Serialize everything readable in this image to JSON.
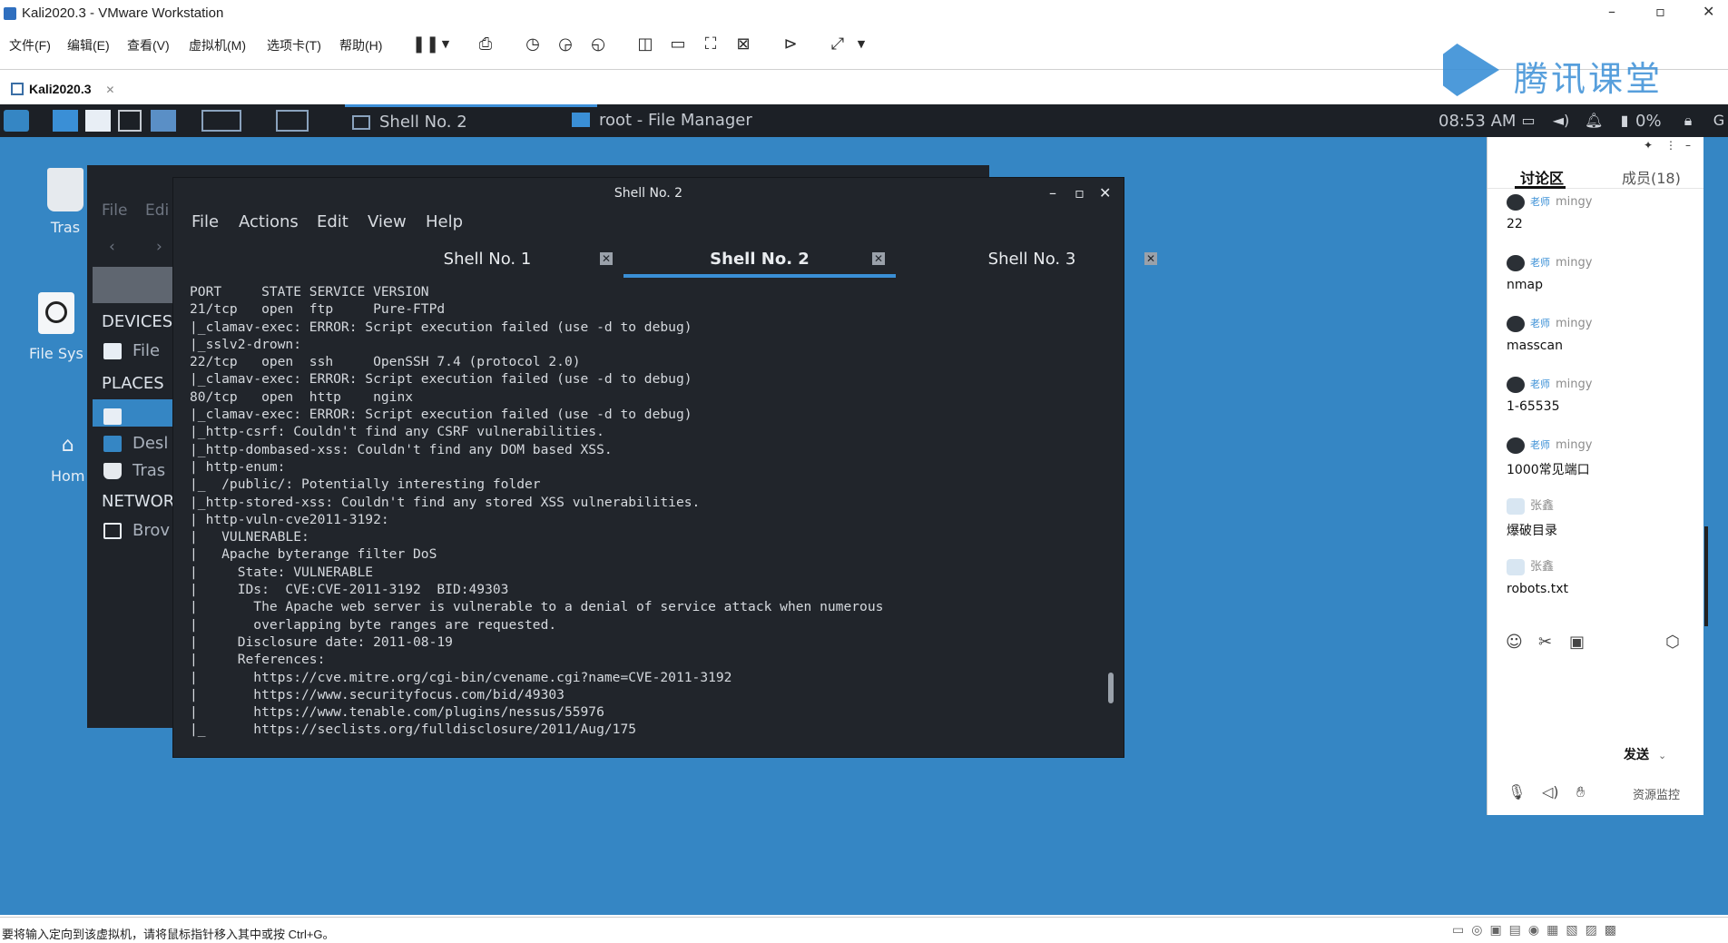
{
  "vmware": {
    "window_title": "Kali2020.3 - VMware Workstation",
    "menu": [
      "文件(F)",
      "编辑(E)",
      "查看(V)",
      "虚拟机(M)",
      "选项卡(T)",
      "帮助(H)"
    ],
    "vm_tab": "Kali2020.3",
    "status_hint": "要将输入定向到该虚拟机，请将鼠标指针移入其中或按 Ctrl+G。"
  },
  "watermark": "腾讯课堂",
  "panel": {
    "tasks": [
      {
        "label": "Shell No. 2",
        "active": true
      },
      {
        "label": "root - File Manager",
        "active": false
      }
    ],
    "clock": "08:53 AM",
    "battery": "0%"
  },
  "desktop_icons": {
    "trash": "Tras",
    "filesystem": "File Sys",
    "home": "Hom"
  },
  "file_manager": {
    "menu": [
      "File",
      "Edi"
    ],
    "sections": {
      "devices": "DEVICES",
      "places": "PLACES",
      "network": "NETWOR"
    },
    "items": {
      "file": "File",
      "desktop": "Desl",
      "trash": "Tras",
      "browse": "Brov"
    }
  },
  "terminal": {
    "title": "Shell No. 2",
    "menu": [
      "File",
      "Actions",
      "Edit",
      "View",
      "Help"
    ],
    "tabs": [
      {
        "label": "Shell No. 1",
        "active": false
      },
      {
        "label": "Shell No. 2",
        "active": true
      },
      {
        "label": "Shell No. 3",
        "active": false
      }
    ],
    "output": "PORT     STATE SERVICE VERSION\n21/tcp   open  ftp     Pure-FTPd\n|_clamav-exec: ERROR: Script execution failed (use -d to debug)\n|_sslv2-drown:\n22/tcp   open  ssh     OpenSSH 7.4 (protocol 2.0)\n|_clamav-exec: ERROR: Script execution failed (use -d to debug)\n80/tcp   open  http    nginx\n|_clamav-exec: ERROR: Script execution failed (use -d to debug)\n|_http-csrf: Couldn't find any CSRF vulnerabilities.\n|_http-dombased-xss: Couldn't find any DOM based XSS.\n| http-enum:\n|_  /public/: Potentially interesting folder\n|_http-stored-xss: Couldn't find any stored XSS vulnerabilities.\n| http-vuln-cve2011-3192:\n|   VULNERABLE:\n|   Apache byterange filter DoS\n|     State: VULNERABLE\n|     IDs:  CVE:CVE-2011-3192  BID:49303\n|       The Apache web server is vulnerable to a denial of service attack when numerous\n|       overlapping byte ranges are requested.\n|     Disclosure date: 2011-08-19\n|     References:\n|       https://cve.mitre.org/cgi-bin/cvename.cgi?name=CVE-2011-3192\n|       https://www.securityfocus.com/bid/49303\n|       https://www.tenable.com/plugins/nessus/55976\n|_      https://seclists.org/fulldisclosure/2011/Aug/175"
  },
  "chat": {
    "tabs": {
      "discussion": "讨论区",
      "members": "成员(18)"
    },
    "messages": [
      {
        "role": "老师",
        "user": "mingy",
        "text": "22"
      },
      {
        "role": "老师",
        "user": "mingy",
        "text": "nmap"
      },
      {
        "role": "老师",
        "user": "mingy",
        "text": "masscan"
      },
      {
        "role": "老师",
        "user": "mingy",
        "text": "1-65535"
      },
      {
        "role": "老师",
        "user": "mingy",
        "text": "1000常见端口"
      },
      {
        "role": "",
        "user": "张鑫",
        "text": "爆破目录"
      },
      {
        "role": "",
        "user": "张鑫",
        "text": "robots.txt"
      }
    ],
    "send_label": "发送",
    "monitor_label": "资源监控"
  },
  "colors": {
    "desktop_bg": "#3586c4",
    "terminal_bg": "#21252b",
    "accent": "#3a8fd6"
  }
}
